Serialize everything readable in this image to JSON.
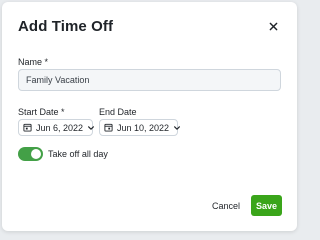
{
  "dialog": {
    "title": "Add Time Off",
    "close_icon": "close-icon"
  },
  "name_field": {
    "label": "Name *",
    "value": "Family Vacation",
    "placeholder": ""
  },
  "start_date": {
    "label": "Start Date *",
    "value": "Jun 6, 2022",
    "icon": "calendar-icon"
  },
  "end_date": {
    "label": "End Date",
    "value": "Jun 10, 2022",
    "icon": "calendar-icon"
  },
  "all_day": {
    "label": "Take off all day",
    "checked": true
  },
  "actions": {
    "cancel_label": "Cancel",
    "save_label": "Save"
  },
  "colors": {
    "accent_green": "#3aa51a",
    "toggle_on": "#43a047",
    "input_background": "#f4f6f8"
  }
}
